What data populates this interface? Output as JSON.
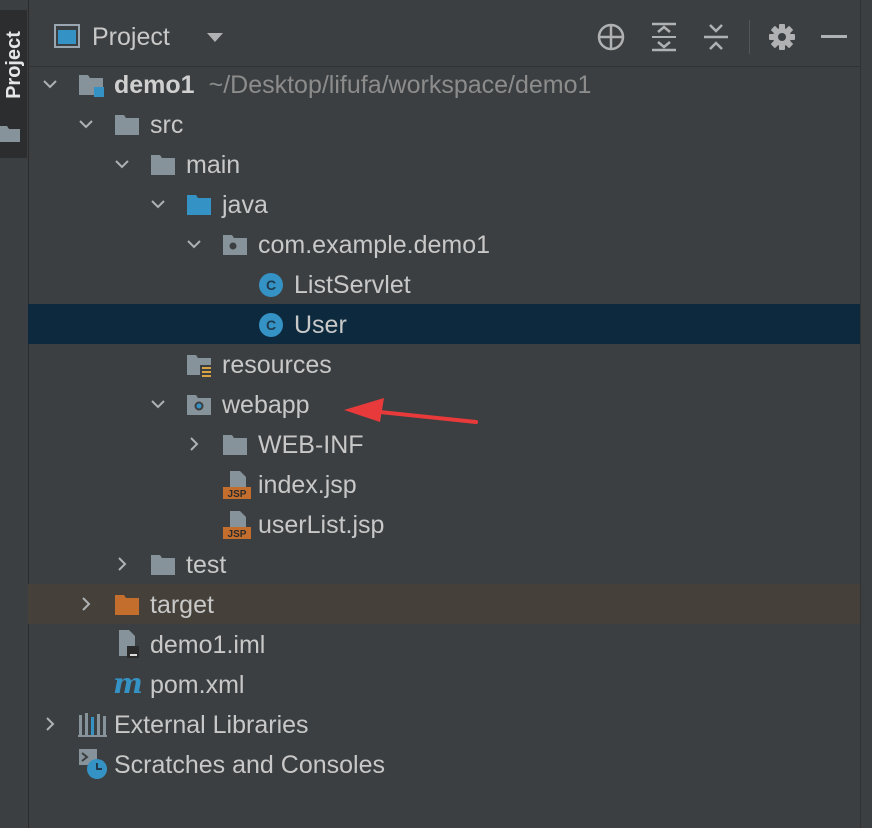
{
  "side_stripe": {
    "label": "Project"
  },
  "toolbar": {
    "title": "Project",
    "buttons": [
      "locate-icon",
      "expand-all-icon",
      "collapse-all-icon",
      "gear-icon",
      "minimize-icon"
    ]
  },
  "tree": {
    "root": {
      "label": "demo1",
      "path": "~/Desktop/lifufa/workspace/demo1"
    },
    "src": "src",
    "main": "main",
    "java": "java",
    "package": "com.example.demo1",
    "class1": "ListServlet",
    "class2": "User",
    "resources": "resources",
    "webapp": "webapp",
    "webinf": "WEB-INF",
    "jsp1": "index.jsp",
    "jsp2": "userList.jsp",
    "test": "test",
    "target": "target",
    "iml": "demo1.iml",
    "pom": "pom.xml",
    "libs": "External Libraries",
    "scratches": "Scratches and Consoles",
    "jsp_badge": "JSP",
    "class_badge": "C",
    "maven_badge": "m"
  },
  "colors": {
    "background": "#3c3f41",
    "selection": "#0d293e",
    "excluded": "#45413a",
    "folder": "#87939a",
    "source_folder": "#3592c4",
    "target_folder": "#c46e2e",
    "annotation_arrow": "#e83a3a"
  }
}
